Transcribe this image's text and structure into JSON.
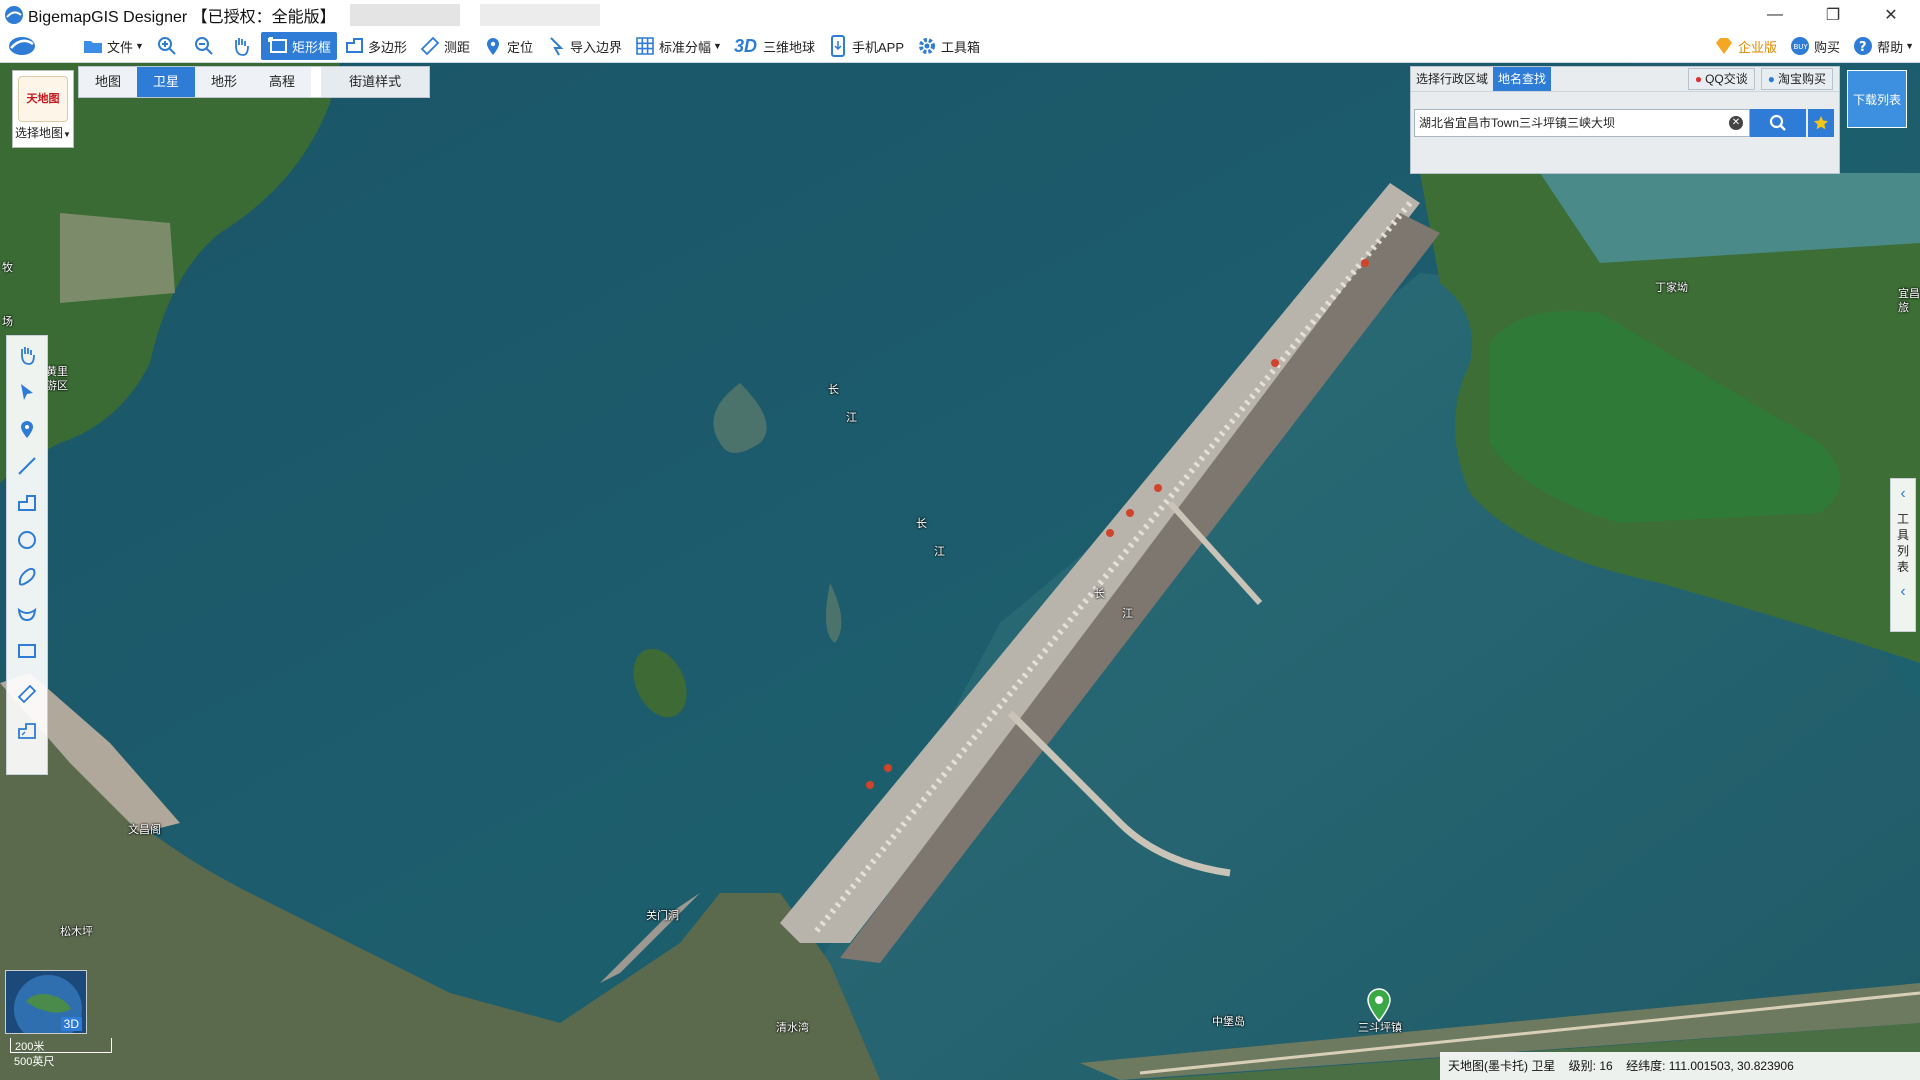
{
  "window": {
    "title": "BigemapGIS Designer 【已授权：全能版】",
    "minimize": "—",
    "restore": "❐",
    "close": "✕"
  },
  "toolbar": {
    "file": "文件",
    "rect": "矩形框",
    "polygon": "多边形",
    "measure": "测距",
    "locate": "定位",
    "import_boundary": "导入边界",
    "tiles": "标准分幅",
    "three_d": "3D",
    "globe": "三维地球",
    "mobile": "手机APP",
    "toolbox": "工具箱",
    "enterprise": "企业版",
    "buy": "购买",
    "help": "帮助"
  },
  "map_select": {
    "logo_text": "天地图",
    "label": "选择地图"
  },
  "map_tabs": [
    "地图",
    "卫星",
    "地形",
    "高程"
  ],
  "map_tab_active": "卫星",
  "street_style": "街道样式",
  "search": {
    "tab_region": "选择行政区域",
    "tab_place": "地名查找",
    "qq": "QQ交谈",
    "taobao": "淘宝购买",
    "value": "湖北省宜昌市Town三斗坪镇三峡大坝"
  },
  "download_list": "下载列表",
  "right_panel": "工具列表",
  "map_labels": {
    "river1": "长",
    "river2": "江",
    "jiajiaoao": "丁家坳",
    "wenchangge": "文昌阁",
    "songmuping": "松木坪",
    "guanmendong": "关门洞",
    "qingshuiwan": "清水湾",
    "zhongbaodao": "中堡岛",
    "sandouping": "三斗坪镇",
    "left1": "牧",
    "left2": "场",
    "left3": "黄里",
    "left4": "游区",
    "right_edge": "宜昌",
    "right_edge2": "旅"
  },
  "scale": {
    "m": "200米",
    "ft": "500英尺"
  },
  "globe_label": "3D",
  "status": {
    "source": "天地图(墨卡托) 卫星",
    "level_label": "级别:",
    "level": "16",
    "coord_label": "经纬度:",
    "coords": "111.001503, 30.823906"
  },
  "colors": {
    "accent": "#2e7cd6",
    "water": "#1e5a6c",
    "land": "#3d6b3a"
  }
}
